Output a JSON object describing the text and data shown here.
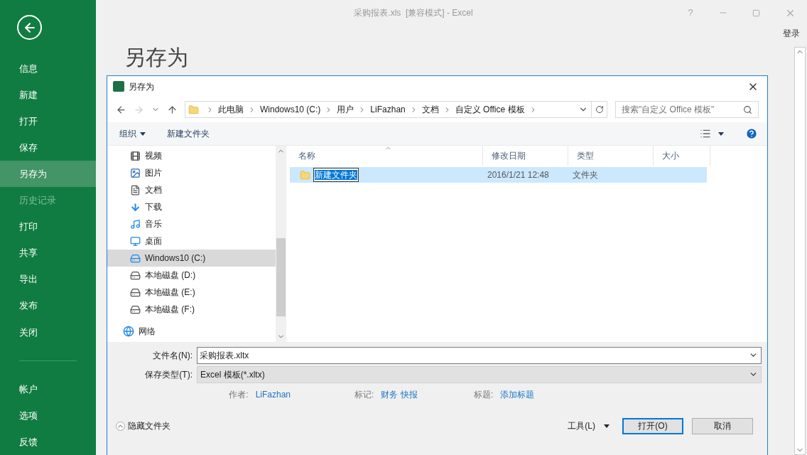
{
  "window": {
    "title": "采购报表.xls  [兼容模式] - Excel",
    "help": "?",
    "sign_in": "登录"
  },
  "backstage": {
    "items": [
      {
        "label": "信息",
        "selected": false,
        "disabled": false
      },
      {
        "label": "新建",
        "selected": false,
        "disabled": false
      },
      {
        "label": "打开",
        "selected": false,
        "disabled": false
      },
      {
        "label": "保存",
        "selected": false,
        "disabled": false
      },
      {
        "label": "另存为",
        "selected": true,
        "disabled": false
      },
      {
        "label": "历史记录",
        "selected": false,
        "disabled": true
      },
      {
        "label": "打印",
        "selected": false,
        "disabled": false
      },
      {
        "label": "共享",
        "selected": false,
        "disabled": false
      },
      {
        "label": "导出",
        "selected": false,
        "disabled": false
      },
      {
        "label": "发布",
        "selected": false,
        "disabled": false
      },
      {
        "label": "关闭",
        "selected": false,
        "disabled": false
      }
    ],
    "bottom_items": [
      {
        "label": "帐户",
        "selected": false,
        "disabled": false
      },
      {
        "label": "选项",
        "selected": false,
        "disabled": false
      },
      {
        "label": "反馈",
        "selected": false,
        "disabled": false
      }
    ]
  },
  "page_title": "另存为",
  "dialog": {
    "title": "另存为",
    "breadcrumb": [
      "此电脑",
      "Windows10 (C:)",
      "用户",
      "LiFazhan",
      "文档",
      "自定义 Office 模板"
    ],
    "search": {
      "placeholder": "搜索\"自定义 Office 模板\""
    },
    "toolbar": {
      "organize": "组织",
      "new_folder": "新建文件夹"
    },
    "nav_pane": [
      {
        "label": "视频",
        "kind": "video",
        "selected": false
      },
      {
        "label": "图片",
        "kind": "pictures",
        "selected": false
      },
      {
        "label": "文档",
        "kind": "documents",
        "selected": false
      },
      {
        "label": "下载",
        "kind": "downloads",
        "selected": false
      },
      {
        "label": "音乐",
        "kind": "music",
        "selected": false
      },
      {
        "label": "桌面",
        "kind": "desktop",
        "selected": false
      },
      {
        "label": "Windows10 (C:)",
        "kind": "system_drive",
        "selected": true
      },
      {
        "label": "本地磁盘 (D:)",
        "kind": "drive",
        "selected": false
      },
      {
        "label": "本地磁盘 (E:)",
        "kind": "drive",
        "selected": false
      },
      {
        "label": "本地磁盘 (F:)",
        "kind": "drive",
        "selected": false
      },
      {
        "label": "网络",
        "kind": "network",
        "selected": false
      }
    ],
    "columns": [
      "名称",
      "修改日期",
      "类型",
      "大小"
    ],
    "rows": [
      {
        "name": "新建文件夹",
        "date": "2016/1/21 12:48",
        "type": "文件夹",
        "selected": true,
        "editing": true
      }
    ],
    "file_name": {
      "label": "文件名(N):",
      "value": "采购报表.xltx"
    },
    "file_type": {
      "label": "保存类型(T):",
      "value": "Excel 模板(*.xltx)"
    },
    "meta": [
      {
        "label": "作者:",
        "value": "LiFazhan"
      },
      {
        "label": "标记:",
        "value": "财务 快报"
      },
      {
        "label": "标题:",
        "value": "添加标题"
      }
    ],
    "hide_folders": "隐藏文件夹",
    "tools": "工具(L)",
    "buttons": [
      {
        "label": "打开(O)",
        "default": true
      },
      {
        "label": "取消",
        "default": false
      }
    ]
  }
}
